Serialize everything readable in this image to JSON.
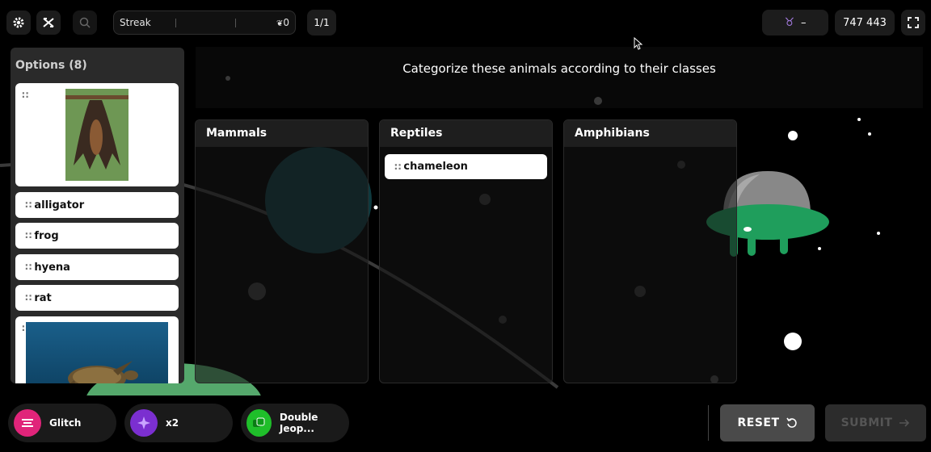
{
  "toolbar": {
    "settings_icon": "gear-icon",
    "no_music_icon": "music-off-icon",
    "zoom_icon": "zoom-icon",
    "streak_label": "Streak",
    "streak_value": "0",
    "question_counter": "1/1",
    "rank_value": "–",
    "score": "747 443",
    "fullscreen_icon": "fullscreen-icon"
  },
  "question": {
    "text": "Categorize these animals according to their classes"
  },
  "options": {
    "title": "Options (8)",
    "items": [
      "alligator",
      "frog",
      "hyena",
      "rat"
    ]
  },
  "categories": [
    {
      "name": "Mammals",
      "items": []
    },
    {
      "name": "Reptiles",
      "items": [
        "chameleon"
      ]
    },
    {
      "name": "Amphibians",
      "items": []
    }
  ],
  "powerups": [
    {
      "label": "Glitch",
      "color": "#e0247a"
    },
    {
      "label": "x2",
      "color": "#7b2fd0"
    },
    {
      "label": "Double Jeop...",
      "color": "#1fbf2a"
    }
  ],
  "actions": {
    "reset_label": "RESET",
    "submit_label": "SUBMIT"
  },
  "colors": {
    "ufo_green": "#1f9e5c",
    "reset_bg": "#4a4a4a",
    "submit_bg": "#2c2c2c"
  }
}
